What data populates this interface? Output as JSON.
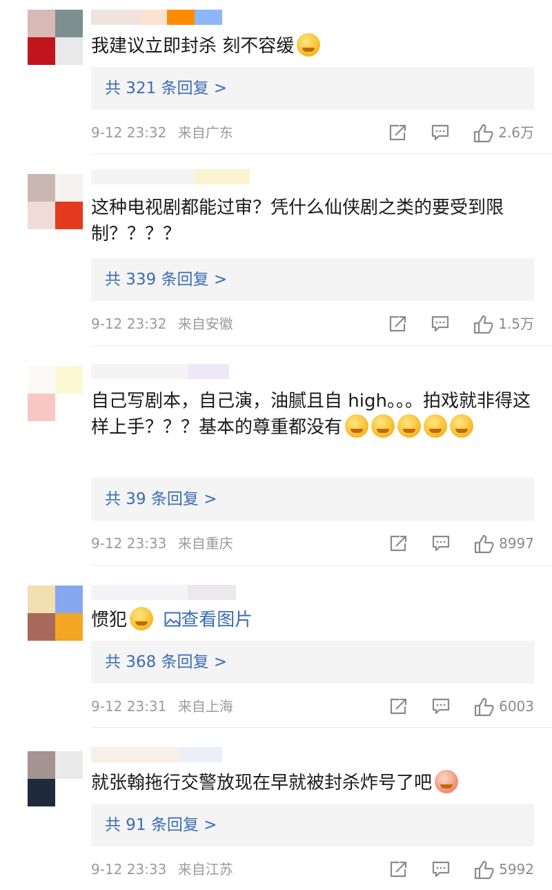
{
  "comments": [
    {
      "text": "我建议立即封杀 刻不容缓",
      "emojis": [
        "crying-face"
      ],
      "replies": "共 321 条回复 >",
      "time": "9-12 23:32",
      "location": "来自广东",
      "likes": "2.6万"
    },
    {
      "text": "这种电视剧都能过审？凭什么仙侠剧之类的要受到限制？？？？",
      "emojis": [],
      "replies": "共 339 条回复 >",
      "time": "9-12 23:32",
      "location": "来自安徽",
      "likes": "1.5万"
    },
    {
      "text": "自己写剧本，自己演，油腻且自 high。。。拍戏就非得这样上手？？？基本的尊重都没有",
      "emojis": [
        "angry-face",
        "angry-face",
        "angry-face",
        "angry-face",
        "angry-face"
      ],
      "replies": "共 39 条回复 >",
      "time": "9-12 23:33",
      "location": "来自重庆",
      "likes": "8997"
    },
    {
      "text": "惯犯",
      "emojis": [
        "crying-face"
      ],
      "link": "查看图片",
      "replies": "共 368 条回复 >",
      "time": "9-12 23:31",
      "location": "来自上海",
      "likes": "6003"
    },
    {
      "text": "就张翰拖行交警放现在早就被封杀炸号了吧",
      "emojis": [
        "laughing-face"
      ],
      "replies": "共 91 条回复 >",
      "time": "9-12 23:33",
      "location": "来自江苏",
      "likes": "5992"
    }
  ],
  "icons": {
    "share": "share-icon",
    "comment": "comment-icon",
    "like": "thumbs-up-icon",
    "image": "image-icon"
  },
  "colors": {
    "link": "#3a6cb3",
    "meta": "#9a9a9a",
    "reply_bg": "#f4f4f4"
  }
}
